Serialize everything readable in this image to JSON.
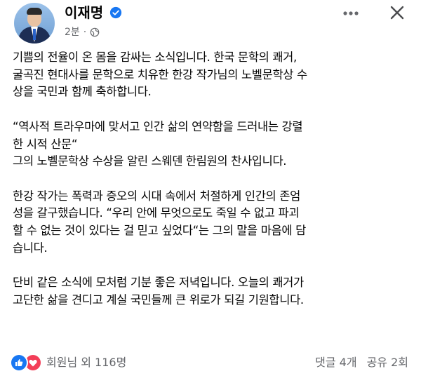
{
  "post": {
    "author": "이재명",
    "time": "2분",
    "meta_separator": "·",
    "paragraphs": [
      {
        "lines": [
          "기쁨의 전율이 온 몸을 감싸는 소식입니다. 한국 문학의 쾌거,",
          "굴곡진 현대사를 문학으로 치유한 한강 작가님의 노벨문학상 수",
          "상을 국민과 함께 축하합니다."
        ]
      },
      {
        "lines": [
          "“역사적 트라우마에 맞서고 인간 삶의 연약함을 드러내는 강렬",
          "한 시적 산문“",
          "그의 노벨문학상 수상을 알린 스웨덴 한림원의 찬사입니다."
        ]
      },
      {
        "lines": [
          "한강 작가는 폭력과 증오의 시대 속에서 처절하게 인간의 존엄",
          "성을 갈구했습니다. “우리 안에 무엇으로도 죽일 수 없고 파괴",
          "할 수 없는 것이 있다는 걸 믿고 싶었다“는 그의 말을 마음에 담",
          "습니다."
        ]
      },
      {
        "lines": [
          "단비 같은 소식에 모처럼 기분 좋은 저녁입니다. 오늘의 쾌거가",
          "고단한 삶을 견디고 계실 국민들께 큰 위로가 되길 기원합니다."
        ]
      }
    ]
  },
  "footer": {
    "reactions_text": "회원님 외 116명",
    "comments": "댓글 4개",
    "shares": "공유 2회"
  },
  "colors": {
    "accent": "#1877f2",
    "love": "#f33e58",
    "secondary_text": "#65676b"
  },
  "icons": [
    "verified-badge-icon",
    "globe-icon",
    "more-options-icon",
    "close-icon",
    "like-reaction-icon",
    "love-reaction-icon"
  ]
}
